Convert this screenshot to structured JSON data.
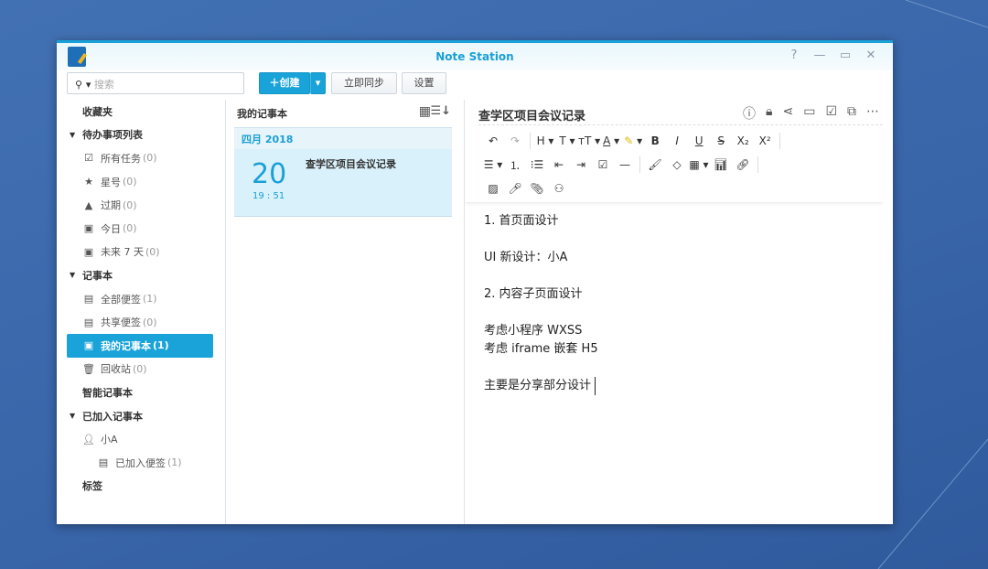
{
  "window": {
    "title": "Note Station",
    "help": "?",
    "minimize": "—",
    "maximize": "▭",
    "close": "✕"
  },
  "toolbar": {
    "search_placeholder": "搜索",
    "create": "创建",
    "sync": "立即同步",
    "settings": "设置"
  },
  "sidebar": {
    "favorites": "收藏夹",
    "todo": "待办事项列表",
    "todo_items": [
      {
        "label": "所有任务",
        "count": "(0)"
      },
      {
        "label": "星号",
        "count": "(0)"
      },
      {
        "label": "过期",
        "count": "(0)"
      },
      {
        "label": "今日",
        "count": "(0)"
      },
      {
        "label": "未来 7 天",
        "count": "(0)"
      }
    ],
    "notebooks": "记事本",
    "notebook_items": [
      {
        "label": "全部便签",
        "count": "(1)"
      },
      {
        "label": "共享便签",
        "count": "(0)"
      },
      {
        "label": "我的记事本",
        "count": "(1)"
      },
      {
        "label": "回收站",
        "count": "(0)"
      }
    ],
    "smart": "智能记事本",
    "joined": "已加入记事本",
    "user": "小A",
    "joined_notes": {
      "label": "已加入便签",
      "count": "(1)"
    },
    "tags": "标签"
  },
  "list": {
    "title": "我的记事本",
    "month": "四月 2018",
    "note": {
      "day": "20",
      "time": "19 : 51",
      "title": "查学区项目会议记录"
    }
  },
  "editor": {
    "title": "查学区项目会议记录",
    "lines": [
      "1. 首页面设计",
      "",
      "UI 新设计：小A",
      "",
      "2. 内容子页面设计",
      "",
      "考虑小程序 WXSS",
      "考虑 iframe 嵌套 H5",
      "",
      "主要是分享部分设计"
    ]
  }
}
